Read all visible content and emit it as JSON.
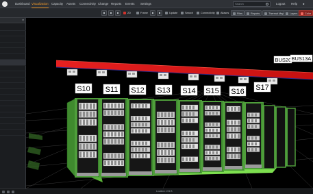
{
  "topnav": {
    "items": [
      "Dashboard",
      "Visualization",
      "Capacity",
      "Assets",
      "Connectivity",
      "Change",
      "Reports",
      "Events",
      "Settings"
    ],
    "active_index": 1,
    "search_placeholder": "Search",
    "user_label": "Logout",
    "help_label": "Help"
  },
  "toolbar": {
    "items": [
      "2D",
      "Frame",
      "Update",
      "Search",
      "Connectivity",
      "Aliases",
      "Files",
      "Reports",
      "Thermal Maps",
      "Layers",
      "Color"
    ]
  },
  "left_panel": {
    "close_glyph": "×",
    "rows": [
      "",
      "",
      "",
      "",
      "",
      "",
      "",
      "",
      "",
      "",
      "",
      "",
      "",
      "",
      "",
      "",
      "",
      "",
      ""
    ]
  },
  "scene": {
    "rack_labels": [
      "S10",
      "S11",
      "S12",
      "S13",
      "S14",
      "S15",
      "S16",
      "S17"
    ],
    "bus_labels": [
      "BUS20",
      "BUS13A"
    ],
    "colors": {
      "busway": "#e01c1c",
      "rack": "#4f9e3b",
      "floor_highlight": "#7ddf4f",
      "grid": "#3a3a3a"
    }
  },
  "status": {
    "location": "Location: 221 B"
  }
}
